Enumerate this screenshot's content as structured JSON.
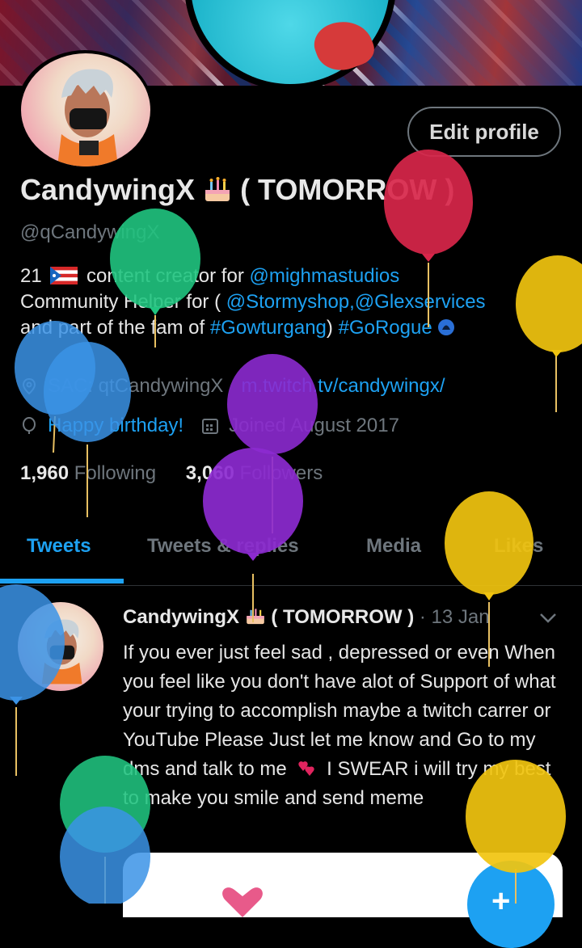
{
  "profile": {
    "display_name": "CandywingX",
    "name_suffix": "( TOMORROW )",
    "handle": "@qCandywingX",
    "edit_label": "Edit profile"
  },
  "bio": {
    "line1_prefix": "21",
    "line1_text": "content creator for",
    "line1_mention": "@mighmastudios",
    "line2_text": "Community Helper for (",
    "line2_mention": "@Stormyshop,@Glexservices",
    "line3_text": "and part of the fam of",
    "line3_tag1": "#Gowturgang",
    "line3_close": ")",
    "line3_tag2": "#GoRogue"
  },
  "meta": {
    "location": "SAC: qtCandywingX",
    "website": "m.twitch.tv/candywingx/",
    "birthday": "Happy birthday!",
    "joined": "Joined August 2017"
  },
  "stats": {
    "following_count": "1,960",
    "following_label": "Following",
    "followers_count": "3,060",
    "followers_label": "Followers"
  },
  "tabs": [
    {
      "label": "Tweets",
      "active": true
    },
    {
      "label": "Tweets & replies",
      "active": false
    },
    {
      "label": "Media",
      "active": false
    },
    {
      "label": "Likes",
      "active": false
    }
  ],
  "tweet": {
    "author": "CandywingX",
    "author_suffix": "( TOMORROW )",
    "date": "· 13 Jan",
    "text_before_emoji": "If you ever just feel sad , depressed or even When you feel like you don't have alot of Support of what your trying to accomplish maybe a twitch carrer or YouTube Please Just let me know and Go to my dms and talk to me",
    "text_after_emoji": "I SWEAR i will try my best to make you smile and send meme"
  },
  "fab": {
    "label": "+"
  },
  "icons": {
    "location": "location-pin-icon",
    "birthday": "balloon-icon",
    "joined": "calendar-icon",
    "menu": "chevron-down-icon",
    "rogue": "rogue-badge-icon",
    "cake": "birthday-cake-emoji",
    "flag": "puerto-rico-flag-emoji",
    "heart": "two-hearts-emoji"
  },
  "colors": {
    "accent": "#1da1f2",
    "background": "#000000",
    "muted": "#6e767d",
    "balloons": [
      "#d8264a",
      "#20c47f",
      "#f1c40f",
      "#3b93e6",
      "#8c2ad0"
    ]
  }
}
